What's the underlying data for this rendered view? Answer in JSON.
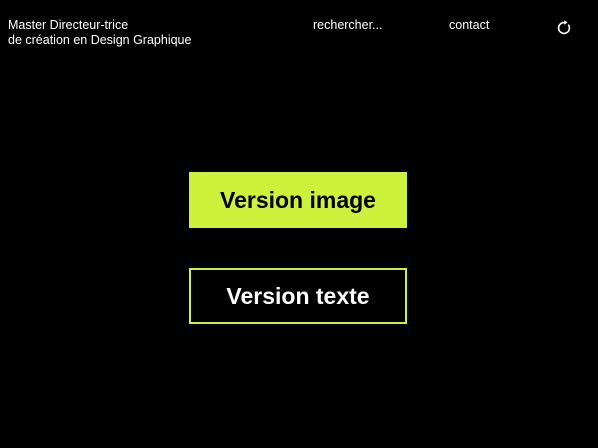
{
  "header": {
    "title_line1": "Master Directeur-trice",
    "title_line2": "de création en Design Graphique",
    "search_label": "rechercher...",
    "contact_label": "contact",
    "refresh_icon": "refresh-icon"
  },
  "main": {
    "version_image_label": "Version image",
    "version_text_label": "Version texte"
  },
  "colors": {
    "background": "#000000",
    "accent": "#cdf23b",
    "text": "#ffffff"
  }
}
